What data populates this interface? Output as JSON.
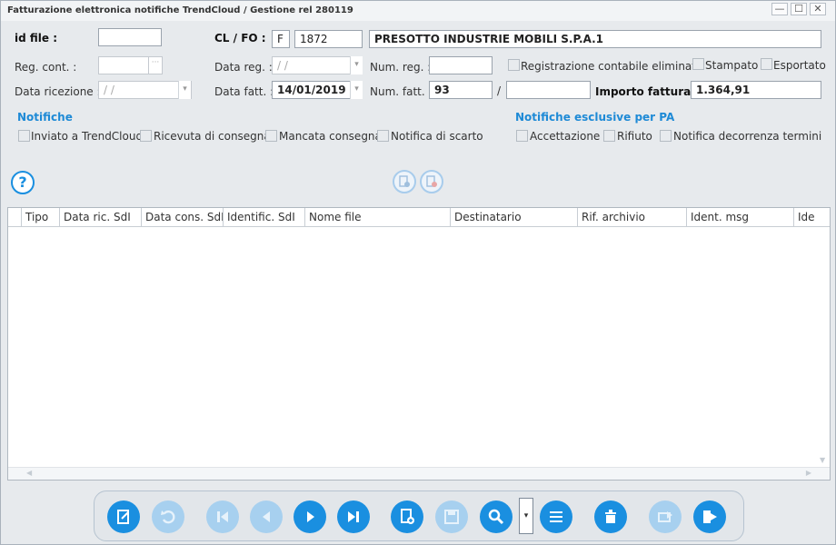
{
  "window": {
    "title": "Fatturazione elettronica notifiche TrendCloud / Gestione rel 280119",
    "controls": [
      "—",
      "☐",
      "✕"
    ]
  },
  "form": {
    "id_file": {
      "label": "id file :",
      "value": ""
    },
    "cl_fo": {
      "label": "CL / FO :",
      "type": "F",
      "code": "1872",
      "name": "PRESOTTO INDUSTRIE MOBILI S.P.A.1"
    },
    "reg_cont": {
      "label": "Reg. cont. :",
      "value": "",
      "button": "···"
    },
    "data_reg": {
      "label": "Data reg. :",
      "value": " /  /"
    },
    "num_reg": {
      "label": "Num. reg. :",
      "value": ""
    },
    "reg_elim": {
      "label": "Registrazione contabile eliminata"
    },
    "stampato": {
      "label": "Stampato"
    },
    "esportato": {
      "label": "Esportato"
    },
    "data_ricezione": {
      "label": "Data ricezione :",
      "value": " /  /"
    },
    "data_fatt": {
      "label": "Data fatt. :",
      "value": "14/01/2019"
    },
    "num_fatt": {
      "label": "Num. fatt. :",
      "value": "93",
      "separator": "/",
      "suffix": ""
    },
    "importo": {
      "label": "Importo fattura :",
      "value": "1.364,91"
    }
  },
  "notifiche": {
    "title": "Notifiche",
    "items": [
      "Inviato a TrendCloud",
      "Ricevuta di consegna",
      "Mancata consegna",
      "Notifica di scarto"
    ]
  },
  "notifiche_pa": {
    "title": "Notifiche esclusive per PA",
    "items": [
      "Accettazione",
      "Rifiuto",
      "Notifica decorrenza termini"
    ]
  },
  "help": {
    "label": "?"
  },
  "grid": {
    "columns": [
      "Tipo",
      "Data ric. SdI",
      "Data cons. SdI",
      "Identific. SdI",
      "Nome file",
      "Destinatario",
      "Rif. archivio",
      "Ident. msg",
      "Ide"
    ]
  },
  "toolbar": {
    "dropdown_arrow": "▾",
    "buttons": [
      {
        "name": "edit",
        "icon": "edit-document-icon",
        "enabled": true
      },
      {
        "name": "undo",
        "icon": "undo-icon",
        "enabled": false
      },
      {
        "name": "first",
        "icon": "first-record-icon",
        "enabled": false
      },
      {
        "name": "prev",
        "icon": "previous-record-icon",
        "enabled": false
      },
      {
        "name": "next",
        "icon": "next-record-icon",
        "enabled": true
      },
      {
        "name": "last",
        "icon": "last-record-icon",
        "enabled": true
      },
      {
        "name": "new",
        "icon": "new-document-icon",
        "enabled": true
      },
      {
        "name": "save",
        "icon": "save-icon",
        "enabled": false
      },
      {
        "name": "search",
        "icon": "search-icon",
        "enabled": true
      },
      {
        "name": "list",
        "icon": "list-icon",
        "enabled": true
      },
      {
        "name": "delete",
        "icon": "delete-icon",
        "enabled": true
      },
      {
        "name": "export",
        "icon": "export-icon",
        "enabled": false
      },
      {
        "name": "exit",
        "icon": "exit-icon",
        "enabled": true
      }
    ]
  },
  "colors": {
    "accent": "#1a8fe0",
    "disabled": "#a7d0ef",
    "section_title": "#1e8ad6"
  }
}
